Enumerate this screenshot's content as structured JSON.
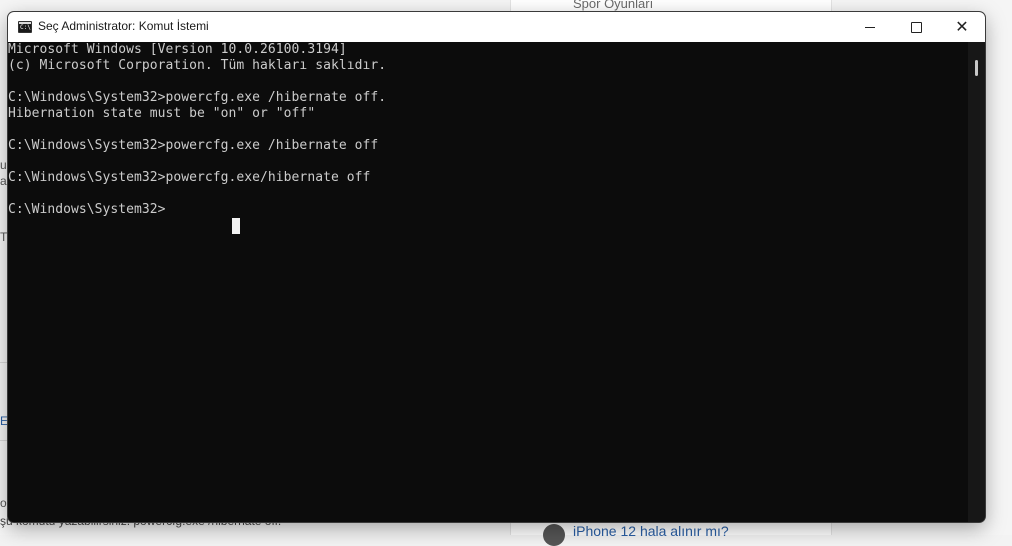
{
  "background": {
    "top_link": "Spor Oyunları",
    "bottom_link": "iPhone 12 hala alınır mı?",
    "bottom_text": "şu komutu yazabilirsiniz: powercfg.exe /hibernate off.",
    "left_fragments": [
      "u",
      "a",
      "T",
      "E",
      "or"
    ]
  },
  "window": {
    "title": "Seç Administrator: Komut İstemi",
    "icon_label": "C:\\",
    "buttons": {
      "minimize_icon": "minimize-icon",
      "maximize_icon": "maximize-icon",
      "close_icon": "close-icon",
      "close_glyph": "✕"
    }
  },
  "console": {
    "lines": [
      "Microsoft Windows [Version 10.0.26100.3194]",
      "(c) Microsoft Corporation. Tüm hakları saklıdır.",
      "",
      "C:\\Windows\\System32>powercfg.exe /hibernate off.",
      "Hibernation state must be \"on\" or \"off\"",
      "",
      "C:\\Windows\\System32>powercfg.exe /hibernate off",
      "",
      "C:\\Windows\\System32>powercfg.exe/hibernate off",
      "",
      "C:\\Windows\\System32>"
    ]
  },
  "colors": {
    "console_bg": "#0c0c0c",
    "console_text": "#cccccc",
    "titlebar_bg": "#ffffff"
  }
}
